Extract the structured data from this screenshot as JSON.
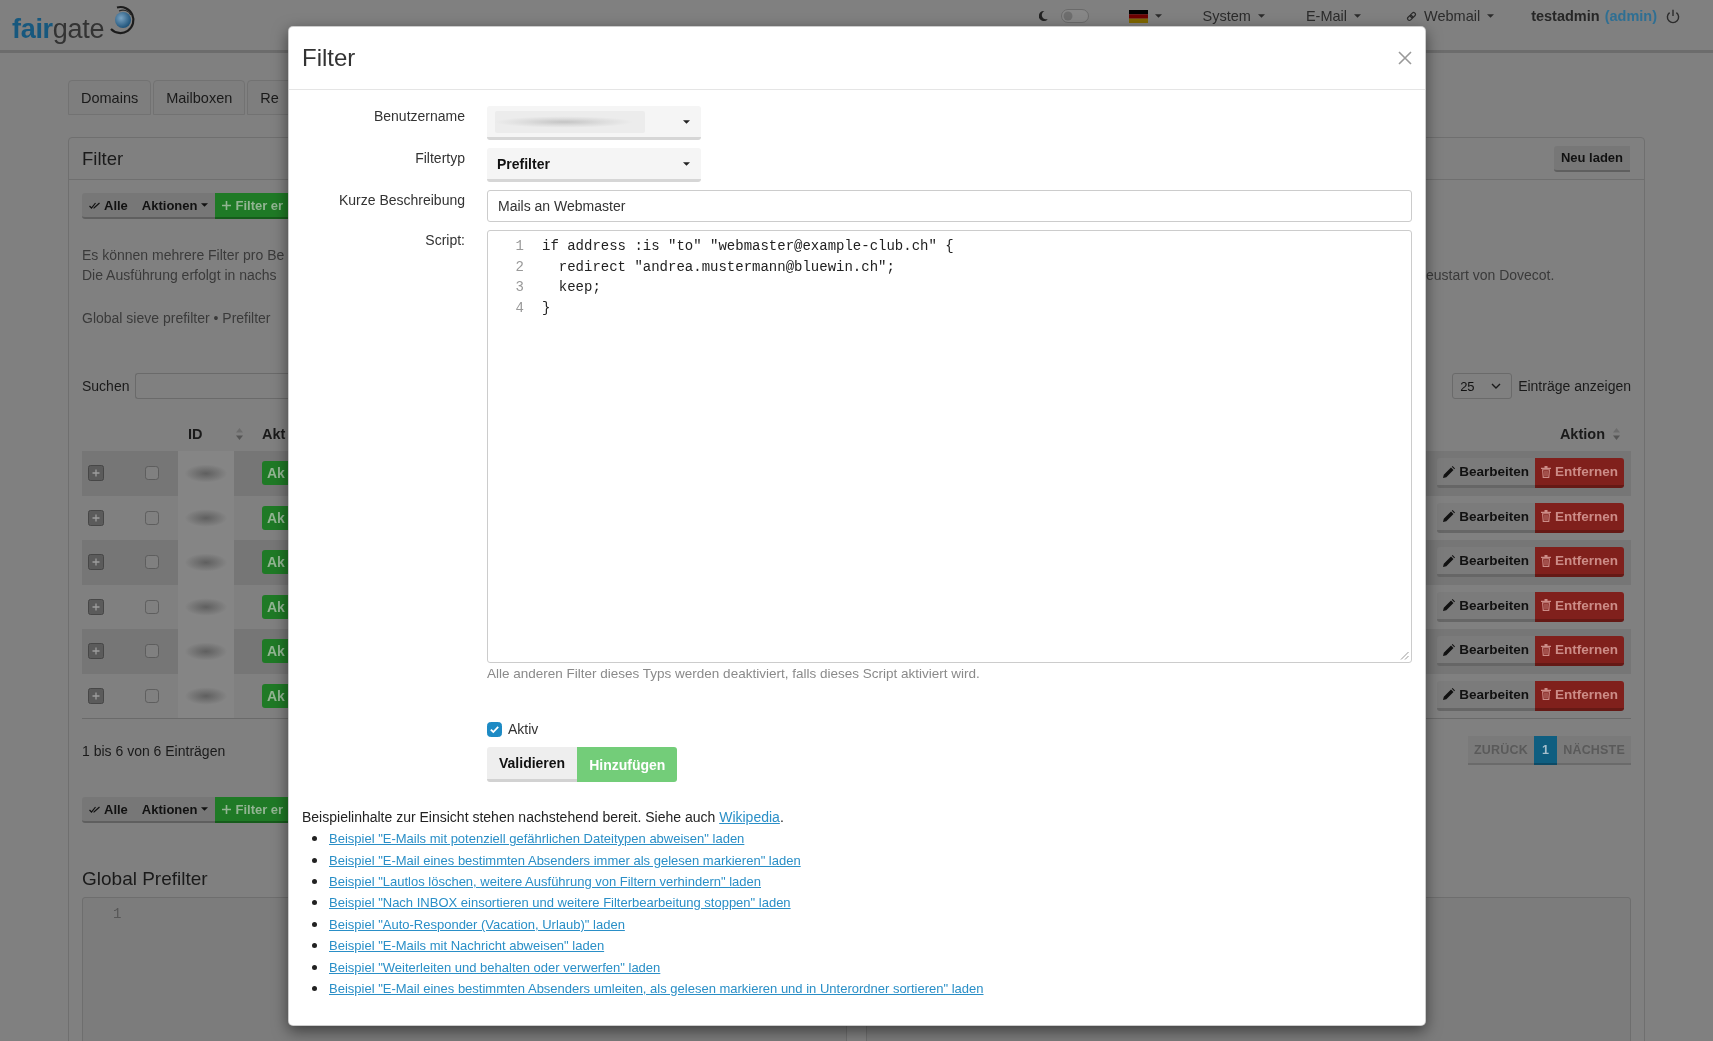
{
  "navbar": {
    "logo": "**fair**gate",
    "dark_mode": {
      "on": false
    },
    "menus": [
      {
        "label": "System",
        "kind": "dropdown"
      },
      {
        "label": "E-Mail",
        "kind": "dropdown"
      },
      {
        "label": "Webmail",
        "kind": "link"
      }
    ],
    "user": {
      "name": "testadmin",
      "role": "(admin)"
    }
  },
  "tabs": [
    {
      "label": "Domains",
      "selected": false
    },
    {
      "label": "Mailboxen",
      "selected": false
    },
    {
      "label": "Re",
      "selected": false
    }
  ],
  "panel": {
    "title": "Filter",
    "reload": "Neu laden",
    "toolbar": {
      "select_all": "Alle",
      "actions": "Aktionen",
      "add": "Filter er"
    },
    "intro_lines": [
      "Es können mehrere Filter pro Be",
      "Die Ausführung erfolgt in nachs"
    ],
    "intro_tail": "eustart von Dovecot.",
    "prefilter_note": "Global sieve prefilter • Prefilter",
    "search_label": "Suchen",
    "page_size": {
      "value": "25",
      "label": "Einträge anzeigen"
    },
    "table": {
      "columns": [
        {
          "label": "ID",
          "sortable": true
        },
        {
          "label": "Akt",
          "sortable": false
        },
        {
          "label": "Aktion",
          "sortable": true
        }
      ],
      "rows": [
        {
          "checked": false,
          "status": "Ak",
          "edit": "Bearbeiten",
          "remove": "Entfernen"
        },
        {
          "checked": false,
          "status": "Ak",
          "edit": "Bearbeiten",
          "remove": "Entfernen"
        },
        {
          "checked": false,
          "status": "Ak",
          "edit": "Bearbeiten",
          "remove": "Entfernen"
        },
        {
          "checked": false,
          "status": "Ak",
          "edit": "Bearbeiten",
          "remove": "Entfernen"
        },
        {
          "checked": false,
          "status": "Ak",
          "edit": "Bearbeiten",
          "remove": "Entfernen"
        },
        {
          "checked": false,
          "status": "Ak",
          "edit": "Bearbeiten",
          "remove": "Entfernen"
        }
      ]
    },
    "info": "1 bis 6 von 6 Einträgen",
    "pagination": [
      {
        "label": "ZURÜCK",
        "selected": false,
        "disabled": true
      },
      {
        "label": "1",
        "selected": true,
        "disabled": false
      },
      {
        "label": "NÄCHSTE",
        "selected": false,
        "disabled": true
      }
    ],
    "toolbar_bottom": {
      "select_all": "Alle",
      "actions": "Aktionen",
      "add": "Filter er"
    },
    "global_prefilter": {
      "title": "Global Prefilter",
      "line_number": "1"
    }
  },
  "modal": {
    "title": "Filter",
    "fields": [
      {
        "label": "Benutzername",
        "kind": "blurred_select"
      },
      {
        "label": "Filtertyp",
        "kind": "select",
        "value": "Prefilter"
      },
      {
        "label": "Kurze Beschreibung",
        "kind": "input",
        "value": "Mails an Webmaster"
      },
      {
        "label": "Script:",
        "kind": "code",
        "lines": [
          {
            "number": "1",
            "text": "if address :is \"to\" \"webmaster@example-club.ch\" {"
          },
          {
            "number": "2",
            "text": "  redirect \"andrea.mustermann@bluewin.ch\";"
          },
          {
            "number": "3",
            "text": "  keep;"
          },
          {
            "number": "4",
            "text": "}"
          }
        ]
      }
    ],
    "help": "Alle anderen Filter dieses Typs werden deaktiviert, falls dieses Script aktiviert wird.",
    "active": {
      "label": "Aktiv",
      "checked": true
    },
    "buttons": [
      {
        "label": "Validieren",
        "kind": "default"
      },
      {
        "label": "Hinzufügen",
        "kind": "success"
      }
    ],
    "examples_intro": {
      "text": "Beispielinhalte zur Einsicht stehen nachstehend bereit. Siehe auch",
      "link": "Wikipedia",
      "end": "."
    },
    "examples": [
      "Beispiel \"E-Mails mit potenziell gefährlichen Dateitypen abweisen\" laden",
      "Beispiel \"E-Mail eines bestimmten Absenders immer als gelesen markieren\" laden",
      "Beispiel \"Lautlos löschen, weitere Ausführung von Filtern verhindern\" laden",
      "Beispiel \"Nach INBOX einsortieren und weitere Filterbearbeitung stoppen\" laden",
      "Beispiel \"Auto-Responder (Vacation, Urlaub)\" laden",
      "Beispiel \"E-Mails mit Nachricht abweisen\" laden",
      "Beispiel \"Weiterleiten und behalten oder verwerfen\" laden",
      "Beispiel \"E-Mail eines bestimmten Absenders umleiten, als gelesen markieren und in Unterordner sortieren\" laden"
    ]
  }
}
